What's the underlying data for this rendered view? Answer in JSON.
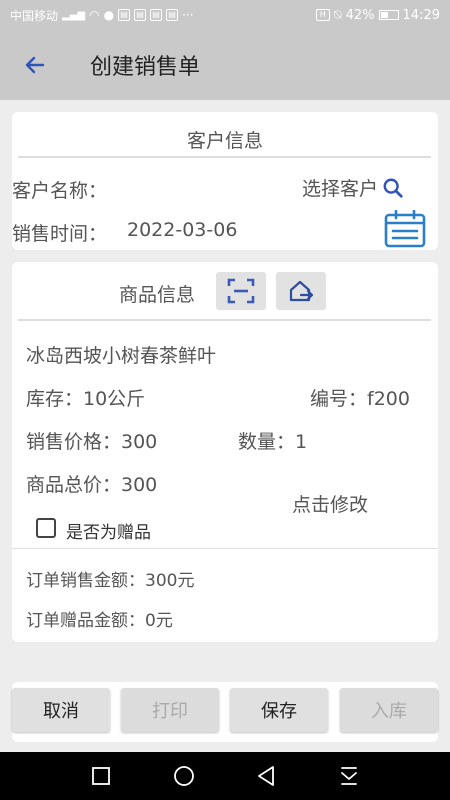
{
  "status_bar": {
    "carrier": "中国移动",
    "signal": "⁴ᴳ",
    "battery_percent": "42%",
    "time": "14:29",
    "more": "···"
  },
  "header": {
    "title": "创建销售单",
    "back_icon": "arrow-left-icon"
  },
  "customer_section": {
    "title": "客户信息",
    "name_label": "客户名称：",
    "select_label": "选择客户",
    "sale_time_label": "销售时间：",
    "sale_time_value": "2022-03-06"
  },
  "product_section": {
    "title": "商品信息",
    "product_name": "冰岛西坡小树春茶鲜叶",
    "stock": "库存：10公斤",
    "code": "编号：f200",
    "price": "销售价格：300",
    "quantity": "数量：1",
    "total": "商品总价：300",
    "edit_label": "点击修改",
    "gift_label": "是否为赠品",
    "order_sales_amount": "订单销售金额：300元",
    "order_gift_amount": "订单赠品金额：0元"
  },
  "buttons": {
    "cancel": "取消",
    "print": "打印",
    "save": "保存",
    "stock_in": "入库"
  },
  "colors": {
    "accent": "#2b7ec9",
    "back_arrow": "#2f55b8",
    "scan_icon": "#3b5bb5"
  }
}
